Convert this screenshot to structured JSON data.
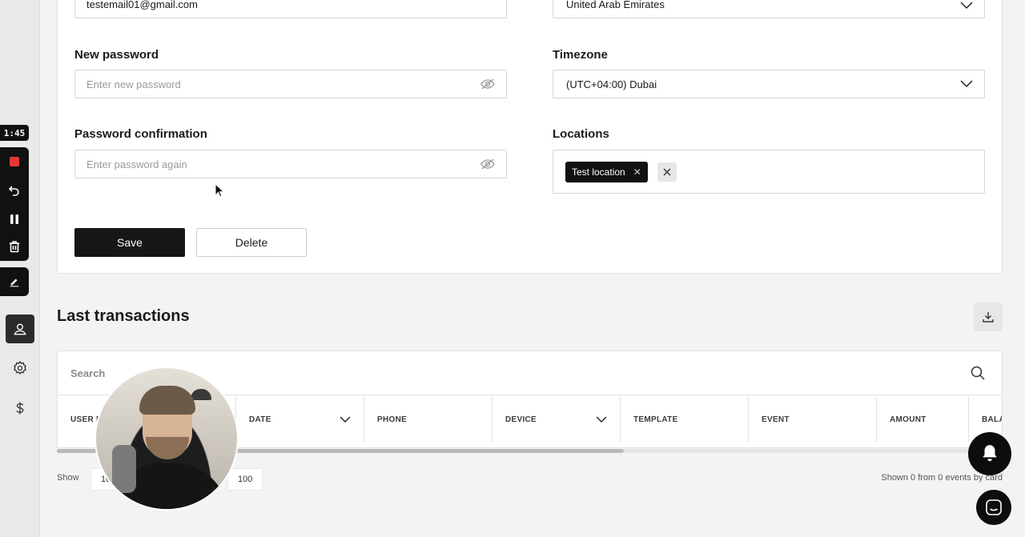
{
  "recorder": {
    "timer": "1:45"
  },
  "form": {
    "email_value": "testemail01@gmail.com",
    "country_value": "United Arab Emirates",
    "new_password_label": "New password",
    "new_password_placeholder": "Enter new password",
    "timezone_label": "Timezone",
    "timezone_value": "(UTC+04:00) Dubai",
    "password_confirmation_label": "Password confirmation",
    "password_confirmation_placeholder": "Enter password again",
    "locations_label": "Locations",
    "locations_chips": [
      "Test location"
    ],
    "save_label": "Save",
    "delete_label": "Delete"
  },
  "transactions": {
    "title": "Last transactions",
    "search_placeholder": "Search",
    "columns": [
      {
        "label": "USER N",
        "sortable": false
      },
      {
        "label": "DATE",
        "sortable": true
      },
      {
        "label": "PHONE",
        "sortable": false
      },
      {
        "label": "DEVICE",
        "sortable": true
      },
      {
        "label": "TEMPLATE",
        "sortable": false
      },
      {
        "label": "EVENT",
        "sortable": false
      },
      {
        "label": "AMOUNT",
        "sortable": false
      },
      {
        "label": "BALA",
        "sortable": false
      }
    ],
    "show_label": "Show",
    "page_sizes": [
      "10",
      "100"
    ],
    "shown_info": "Shown 0 from 0 events by card"
  },
  "colors": {
    "primary": "#161616",
    "recording_red": "#e53935",
    "background": "#f3f3f3"
  }
}
